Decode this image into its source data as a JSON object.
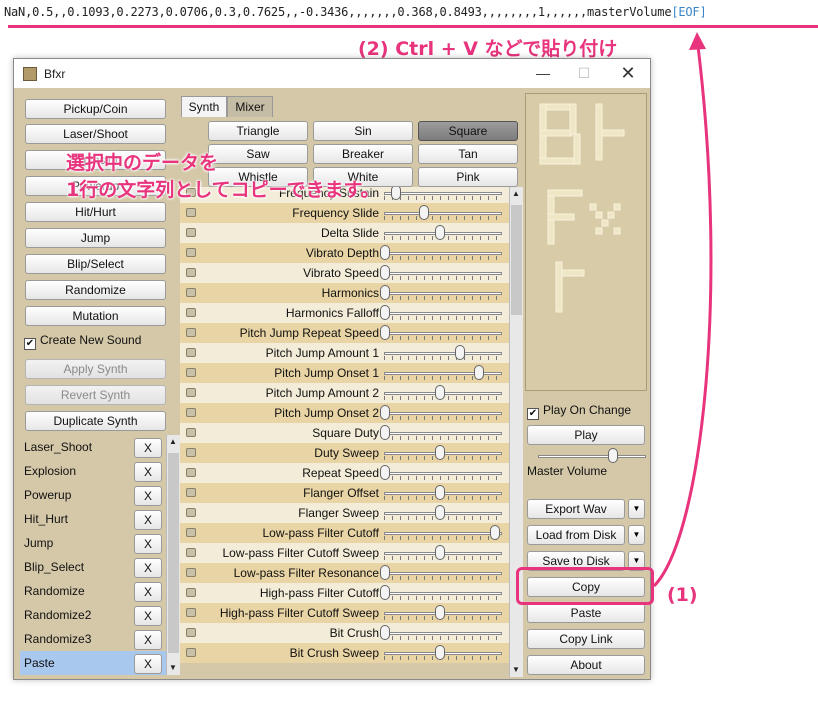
{
  "editor": {
    "line_text": "NaN,0.5,,0.1093,0.2273,0.0706,0.3,0.7625,,-0.3436,,,,,,,0.368,0.8493,,,,,,,,1,,,,,,masterVolume",
    "eof": "[EOF]"
  },
  "annotations": {
    "step2": "(2) Ctrl + V などで貼り付け",
    "overlay_line1": "選択中のデータを",
    "overlay_line2": "1行の文字列としてコピーできます。",
    "step1": "(1)",
    "accent_color": "#e8337d"
  },
  "window": {
    "title": "Bfxr",
    "minimize": "—",
    "maximize": "☐",
    "close": "✕"
  },
  "left": {
    "buttons": [
      "Pickup/Coin",
      "Laser/Shoot",
      "Explosion",
      "Powerup",
      "Hit/Hurt",
      "Jump",
      "Blip/Select",
      "Randomize",
      "Mutation"
    ],
    "create_new_sound": "Create New Sound",
    "create_new_checked": true,
    "apply_synth": "Apply Synth",
    "revert_synth": "Revert Synth",
    "duplicate_synth": "Duplicate Synth",
    "sounds": [
      {
        "name": "Laser_Shoot",
        "x": "X"
      },
      {
        "name": "Explosion",
        "x": "X"
      },
      {
        "name": "Powerup",
        "x": "X"
      },
      {
        "name": "Hit_Hurt",
        "x": "X"
      },
      {
        "name": "Jump",
        "x": "X"
      },
      {
        "name": "Blip_Select",
        "x": "X"
      },
      {
        "name": "Randomize",
        "x": "X"
      },
      {
        "name": "Randomize2",
        "x": "X"
      },
      {
        "name": "Randomize3",
        "x": "X"
      },
      {
        "name": "Paste",
        "x": "X"
      }
    ],
    "active_sound": "Paste"
  },
  "tabs": {
    "synth": "Synth",
    "mixer": "Mixer",
    "active": "Synth"
  },
  "waves": {
    "items": [
      "Triangle",
      "Sin",
      "Square",
      "Saw",
      "Breaker",
      "Tan",
      "Whistle",
      "White",
      "Pink"
    ],
    "selected": "Square"
  },
  "params": [
    {
      "label": "Frequency Sustain",
      "value": 0.1
    },
    {
      "label": "Frequency Slide",
      "value": 0.35
    },
    {
      "label": "Delta Slide",
      "value": 0.5
    },
    {
      "label": "Vibrato Depth",
      "value": 0.0
    },
    {
      "label": "Vibrato Speed",
      "value": 0.0
    },
    {
      "label": "Harmonics",
      "value": 0.0
    },
    {
      "label": "Harmonics Falloff",
      "value": 0.0
    },
    {
      "label": "Pitch Jump Repeat Speed",
      "value": 0.0
    },
    {
      "label": "Pitch Jump Amount 1",
      "value": 0.68
    },
    {
      "label": "Pitch Jump Onset 1",
      "value": 0.85
    },
    {
      "label": "Pitch Jump Amount 2",
      "value": 0.5
    },
    {
      "label": "Pitch Jump Onset 2",
      "value": 0.0
    },
    {
      "label": "Square Duty",
      "value": 0.0
    },
    {
      "label": "Duty Sweep",
      "value": 0.5
    },
    {
      "label": "Repeat Speed",
      "value": 0.0
    },
    {
      "label": "Flanger Offset",
      "value": 0.5
    },
    {
      "label": "Flanger Sweep",
      "value": 0.5
    },
    {
      "label": "Low-pass Filter Cutoff",
      "value": 1.0
    },
    {
      "label": "Low-pass Filter Cutoff Sweep",
      "value": 0.5
    },
    {
      "label": "Low-pass Filter Resonance",
      "value": 0.0
    },
    {
      "label": "High-pass Filter Cutoff",
      "value": 0.0
    },
    {
      "label": "High-pass Filter Cutoff Sweep",
      "value": 0.5
    },
    {
      "label": "Bit Crush",
      "value": 0.0
    },
    {
      "label": "Bit Crush Sweep",
      "value": 0.5
    }
  ],
  "right": {
    "play_on_change": "Play On Change",
    "play_on_change_checked": true,
    "play": "Play",
    "master_volume": "Master Volume",
    "master_volume_value": 0.7,
    "export_wav": "Export Wav",
    "load_from_disk": "Load from Disk",
    "save_to_disk": "Save to Disk",
    "copy": "Copy",
    "paste": "Paste",
    "copy_link": "Copy Link",
    "about": "About",
    "dropdown": "▼"
  }
}
